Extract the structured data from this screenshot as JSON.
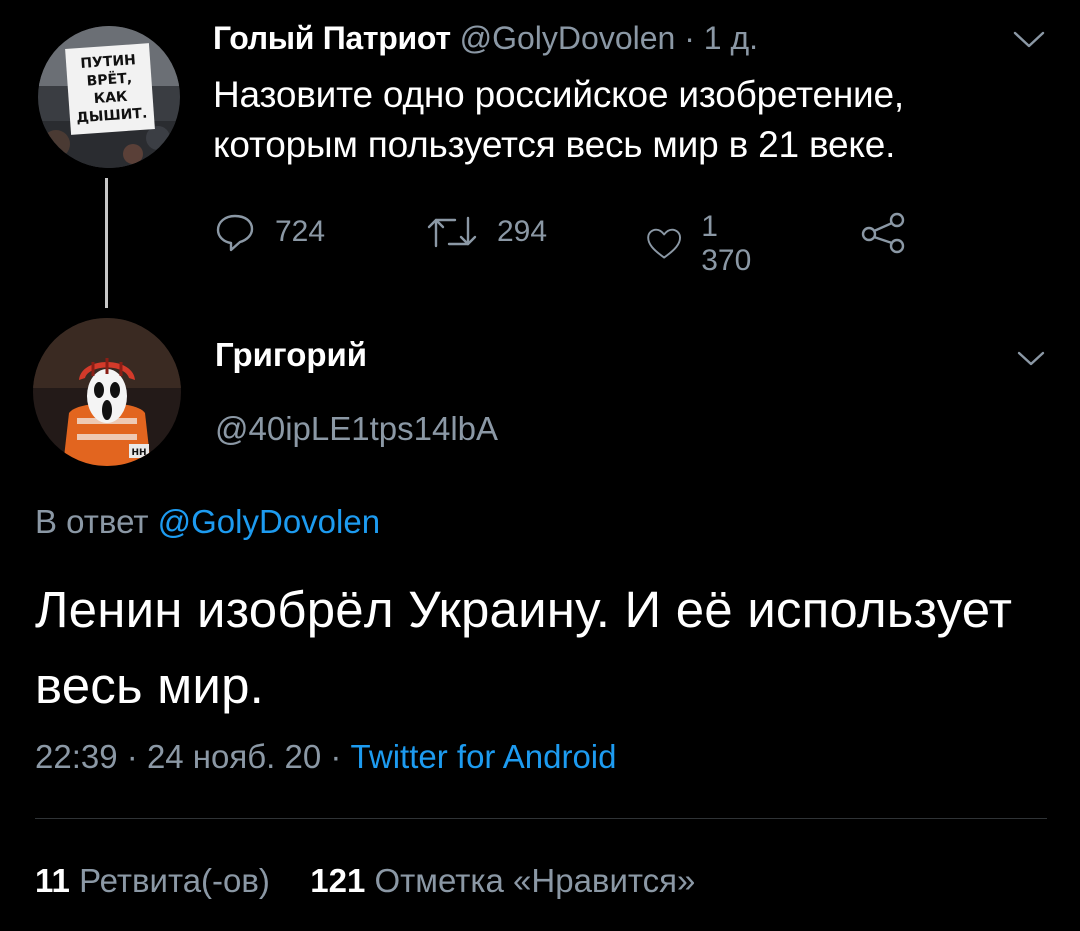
{
  "parent_tweet": {
    "author_name": "Голый Патриот",
    "handle": "@GolyDovolen",
    "separator": "·",
    "age": "1 д.",
    "text": "Назовите одно российское изобретение, которым пользуется весь мир в 21 веке.",
    "avatar_sign_lines": [
      "ПУТИН",
      "ВРЁТ,",
      "КАК",
      "ДЫШИТ."
    ],
    "actions": {
      "reply_icon": "reply-bubble-icon",
      "reply_count": "724",
      "retweet_icon": "retweet-icon",
      "retweet_count": "294",
      "like_icon": "heart-icon",
      "like_count": "1 370",
      "share_icon": "share-icon"
    }
  },
  "reply_tweet": {
    "author_name": "Григорий",
    "handle": "@40ipLE1tps14lbA",
    "reply_to_prefix": "В ответ",
    "reply_to_handle": "@GolyDovolen",
    "text": "Ленин изобрёл Украину. И её использует весь мир.",
    "time": "22:39",
    "sep1": "·",
    "date": "24 нояб. 20",
    "sep2": "·",
    "client": "Twitter for Android",
    "avatar_badge": "HH",
    "stats": {
      "retweet_count": "11",
      "retweet_label": "Ретвита(-ов)",
      "like_count": "121",
      "like_label": "Отметка «Нравится»"
    }
  },
  "colors": {
    "background": "#000000",
    "text_primary": "#ffffff",
    "text_muted": "#8b98a5",
    "link": "#1d9bf0",
    "divider": "#2f3336"
  }
}
